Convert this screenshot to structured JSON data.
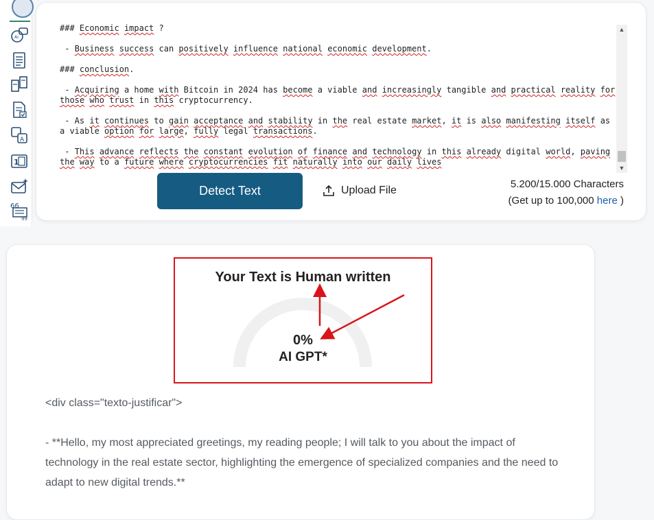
{
  "sidebar": {
    "icons": [
      "brain-logo-icon",
      "ai-chat-icon",
      "document-list-icon",
      "compare-icon",
      "document-check-icon",
      "translate-icon",
      "counter-icon",
      "mail-sparkle-icon",
      "quote-icon"
    ]
  },
  "editor": {
    "lines": [
      [
        "### ",
        {
          "sq": "Economic"
        },
        " ",
        {
          "sq": "impact"
        },
        " ?"
      ],
      [
        " - ",
        {
          "sq": "Business"
        },
        " ",
        {
          "sq": "success"
        },
        " can ",
        {
          "sq": "positively"
        },
        " ",
        {
          "sq": "influence"
        },
        " ",
        {
          "sq": "national"
        },
        " ",
        {
          "sq": "economic"
        },
        " ",
        {
          "sq": "development"
        },
        "."
      ],
      [
        "### ",
        {
          "sq": "conclusion"
        },
        "."
      ],
      [
        " - ",
        {
          "sq": "Acquiring"
        },
        " a home ",
        {
          "sq": "with"
        },
        " Bitcoin in 2024 has ",
        {
          "sq": "become"
        },
        " a viable ",
        {
          "sq": "and"
        },
        " ",
        {
          "sq": "increasingly"
        },
        " tangible ",
        {
          "sq": "and"
        },
        " ",
        {
          "sq": "practical"
        },
        " ",
        {
          "sq": "reality"
        },
        " ",
        {
          "sq": "for"
        },
        " ",
        {
          "sq": "those"
        },
        " ",
        {
          "sq": "who"
        },
        " ",
        {
          "sq": "trust"
        },
        " in ",
        {
          "sq": "this"
        },
        " cryptocurrency."
      ],
      [
        " - As ",
        {
          "sq": "it"
        },
        " ",
        {
          "sq": "continues"
        },
        " to ",
        {
          "sq": "gain"
        },
        " ",
        {
          "sq": "acceptance"
        },
        " ",
        {
          "sq": "and"
        },
        " ",
        {
          "sq": "stability"
        },
        " in ",
        {
          "sq": "the"
        },
        " real estate ",
        {
          "sq": "market"
        },
        ", ",
        {
          "sq": "it"
        },
        " is ",
        {
          "sq": "also"
        },
        " ",
        {
          "sq": "manifesting"
        },
        " ",
        {
          "sq": "itself"
        },
        " as a viable ",
        {
          "sq": "option"
        },
        " ",
        {
          "sq": "for"
        },
        " ",
        {
          "sq": "large"
        },
        ", ",
        {
          "sq": "fully"
        },
        " legal ",
        {
          "sq": "transactions"
        },
        "."
      ],
      [
        " - ",
        {
          "sq": "This"
        },
        " ",
        {
          "sq": "advance"
        },
        " ",
        {
          "sq": "reflects"
        },
        " ",
        {
          "sq": "the"
        },
        " ",
        {
          "sq": "constant"
        },
        " ",
        {
          "sq": "evolution"
        },
        " ",
        {
          "sq": "of"
        },
        " ",
        {
          "sq": "finance"
        },
        " ",
        {
          "sq": "and"
        },
        " ",
        {
          "sq": "technology"
        },
        " in ",
        {
          "sq": "this"
        },
        " ",
        {
          "sq": "already"
        },
        " digital ",
        {
          "sq": "world"
        },
        ", ",
        {
          "sq": "paving"
        },
        " ",
        {
          "sq": "the"
        },
        " ",
        {
          "sq": "way"
        },
        " to a ",
        {
          "sq": "future"
        },
        " ",
        {
          "sq": "where"
        },
        " ",
        {
          "sq": "cryptocurrencies"
        },
        " ",
        {
          "sq": "fit"
        },
        " ",
        {
          "sq": "naturally"
        },
        " ",
        {
          "sq": "into"
        },
        " ",
        {
          "sq": "our"
        },
        " ",
        {
          "sq": "daily"
        },
        " ",
        {
          "sq": "lives"
        }
      ]
    ]
  },
  "toolbar": {
    "detect_label": "Detect Text",
    "upload_label": "Upload File",
    "char_count": "5.200/15.000 Characters",
    "upgrade_prefix": "(Get up to 100,000 ",
    "upgrade_link": "here",
    "upgrade_suffix": " )"
  },
  "result": {
    "title": "Your Text is Human written",
    "percent": "0%",
    "percent_value": 0,
    "label": "AI GPT*",
    "highlight_color": "#d9141a"
  },
  "body": {
    "paragraphs": [
      "<div class=\"texto-justificar\">",
      "- **Hello, my most appreciated greetings, my reading people; I will talk to you about the impact of technology in the real estate sector, highlighting the emergence of specialized companies and the need to adapt to new digital trends.**"
    ]
  },
  "colors": {
    "primary_button": "#165b82",
    "link": "#1a5fa8",
    "gauge_track": "#f0f0f0"
  }
}
